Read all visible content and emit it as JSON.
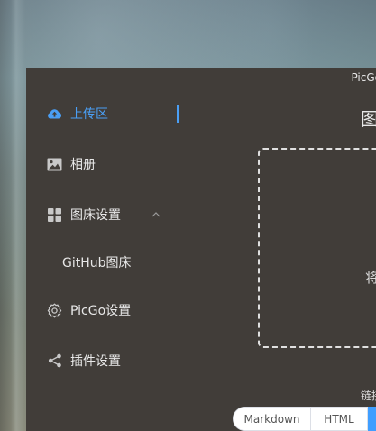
{
  "window": {
    "title": "PicGo"
  },
  "sidebar": {
    "items": [
      {
        "label": "上传区",
        "icon": "cloud-upload-icon",
        "active": true
      },
      {
        "label": "相册",
        "icon": "image-icon",
        "active": false
      },
      {
        "label": "图床设置",
        "icon": "grid-icon",
        "active": false,
        "expanded": true
      },
      {
        "label": "GitHub图床",
        "icon": "",
        "active": false,
        "sub": true
      },
      {
        "label": "PicGo设置",
        "icon": "gear-icon",
        "active": false
      },
      {
        "label": "插件设置",
        "icon": "share-icon",
        "active": false
      }
    ]
  },
  "main": {
    "title": "图",
    "upload_hint": "将",
    "link_format_label": "链接",
    "formats": [
      "Markdown",
      "HTML",
      ""
    ]
  },
  "colors": {
    "accent": "#409eff",
    "window_bg": "#413d39",
    "text": "#e8e8e8"
  }
}
